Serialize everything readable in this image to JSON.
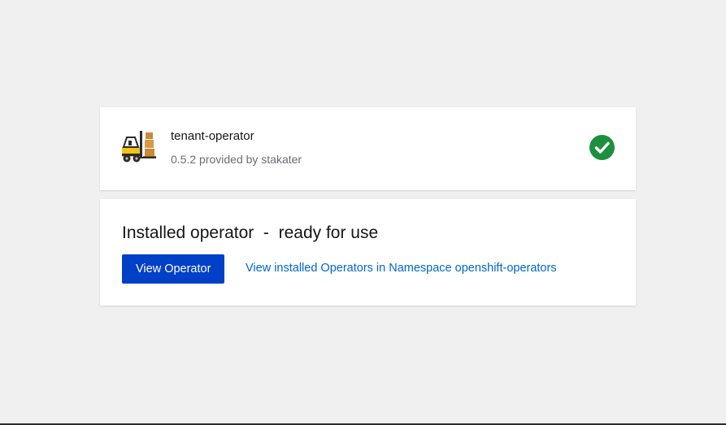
{
  "operator": {
    "name": "tenant-operator",
    "version_provider": "0.5.2 provided by stakater",
    "logo_icon": "forklift-icon",
    "status_icon": "check-circle-icon",
    "status_color": "#1e8f3e"
  },
  "install_status": {
    "title": "Installed operator  -  ready for use",
    "view_button": "View Operator",
    "namespace_link": "View installed Operators in Namespace openshift-operators"
  },
  "colors": {
    "primary_button": "#0040c7",
    "link": "#0066cc",
    "background": "#f0f0f0"
  }
}
